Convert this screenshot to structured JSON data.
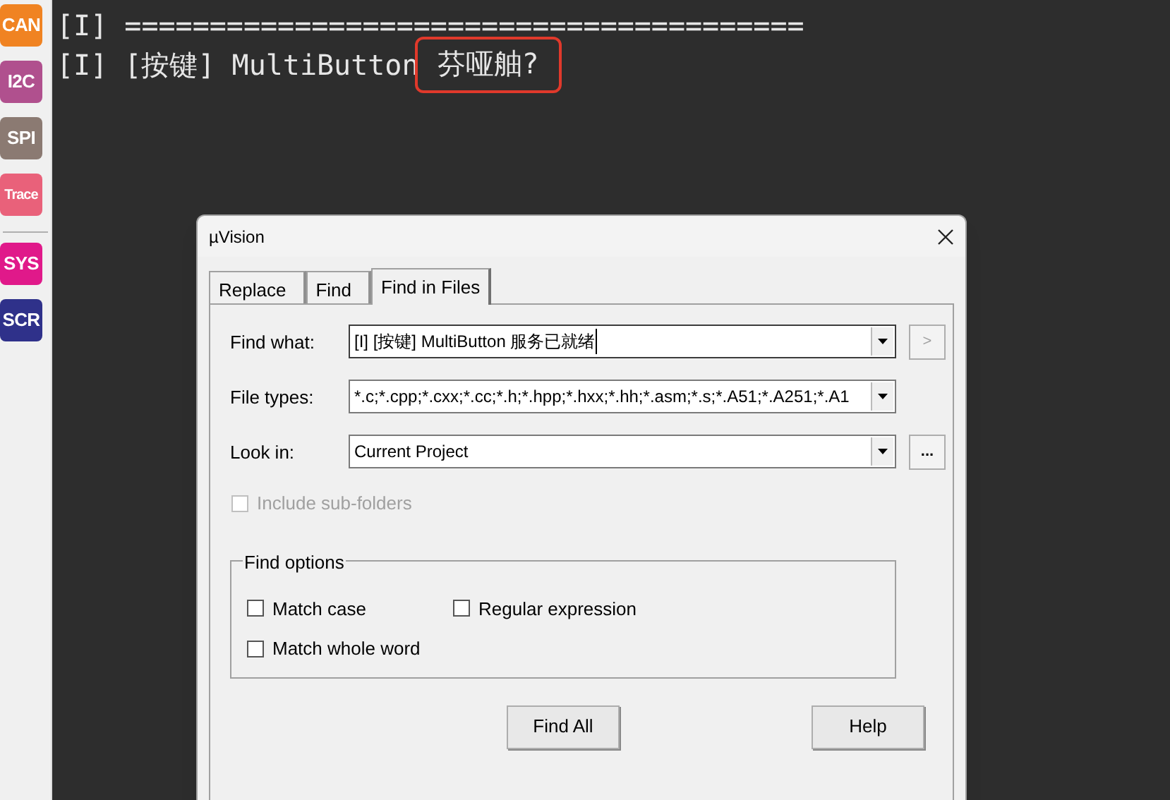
{
  "sidebar": {
    "badge_groups": [
      {
        "badges": [
          {
            "label": "CAN",
            "color": "#f08322"
          },
          {
            "label": "I2C",
            "color": "#b0508e"
          },
          {
            "label": "SPI",
            "color": "#8b7a72"
          },
          {
            "label": "Trace",
            "color": "#e9617a"
          }
        ]
      },
      {
        "badges": [
          {
            "label": "SYS",
            "color": "#e0198a"
          },
          {
            "label": "SCR",
            "color": "#2f318a"
          }
        ]
      }
    ]
  },
  "terminal": {
    "lines": [
      {
        "segments": [
          {
            "text": "[I] ========================================",
            "highlighted": false
          }
        ]
      },
      {
        "segments": [
          {
            "text": "[I] [按键] MultiButton",
            "highlighted": false
          },
          {
            "text": "芬哑舳?",
            "highlighted": true
          }
        ]
      }
    ]
  },
  "dialog": {
    "title": "µVision",
    "tabs": [
      {
        "label": "Replace",
        "selected": false
      },
      {
        "label": "Find",
        "selected": false
      },
      {
        "label": "Find in Files",
        "selected": true
      }
    ],
    "fields": [
      {
        "label": "Find what:",
        "value": "[I] [按键] MultiButton 服务已就绪",
        "focused": true,
        "side_button": {
          "label": ">",
          "disabled": true
        }
      },
      {
        "label": "File types:",
        "value": "*.c;*.cpp;*.cxx;*.cc;*.h;*.hpp;*.hxx;*.hh;*.asm;*.s;*.A51;*.A251;*.A1",
        "focused": false
      },
      {
        "label": "Look in:",
        "value": "Current Project",
        "focused": false,
        "side_button": {
          "label": "...",
          "disabled": false
        }
      }
    ],
    "include_subfolders": {
      "label": "Include sub-folders",
      "checked": false,
      "disabled": true
    },
    "find_options": {
      "title": "Find options",
      "checkboxes": [
        {
          "label": "Match case",
          "checked": false
        },
        {
          "label": "Regular expression",
          "checked": false
        },
        {
          "label": "Match whole word",
          "checked": false
        }
      ]
    },
    "buttons": [
      "Find All",
      "Help"
    ]
  }
}
